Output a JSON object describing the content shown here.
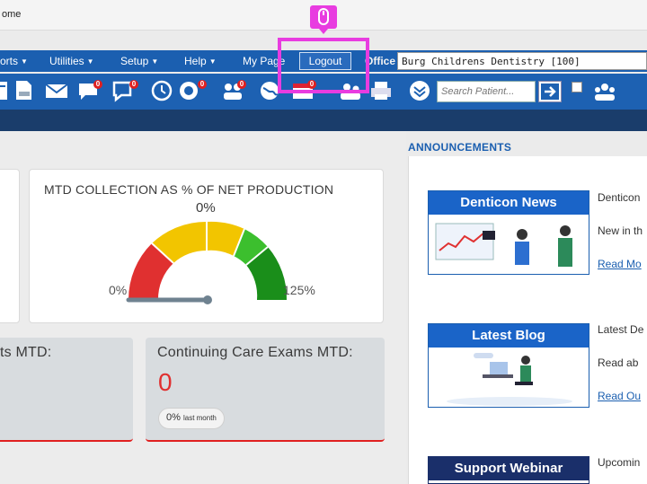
{
  "browser": {
    "title": "ome"
  },
  "menu": {
    "items": [
      {
        "label": "orts"
      },
      {
        "label": "Utilities"
      },
      {
        "label": "Setup"
      },
      {
        "label": "Help"
      },
      {
        "label": "My Page"
      }
    ],
    "logout_label": "Logout",
    "office_label": "Office",
    "office_value": "Burg Childrens Dentistry [100]"
  },
  "toolbar": {
    "badges": [
      "0",
      "0",
      "0",
      "0",
      "0"
    ],
    "search_placeholder": "Search Patient..."
  },
  "gauge_card": {
    "title": "MTD COLLECTION AS % OF NET PRODUCTION",
    "value": "0%",
    "min": "0%",
    "max": "125%",
    "level_percent": 0
  },
  "stat_left": {
    "title": "ts MTD:"
  },
  "stat_right": {
    "title": "Continuing Care Exams MTD:",
    "value": "0",
    "pill_value": "0%",
    "pill_suffix": "last month"
  },
  "announcements": {
    "title": "ANNOUNCEMENTS",
    "items": [
      {
        "tile": "Denticon News",
        "head": "Denticon",
        "text": "New in th",
        "link": "Read Mo"
      },
      {
        "tile": "Latest Blog",
        "head": "Latest De",
        "text": "Read ab",
        "link": "Read Ou"
      },
      {
        "tile": "Support Webinar",
        "head": "Upcomin"
      }
    ]
  },
  "colors": {
    "menu_blue": "#1b5fb0",
    "dark_band": "#1a3d6b",
    "highlight": "#e83ce0",
    "alert_red": "#e03030"
  }
}
